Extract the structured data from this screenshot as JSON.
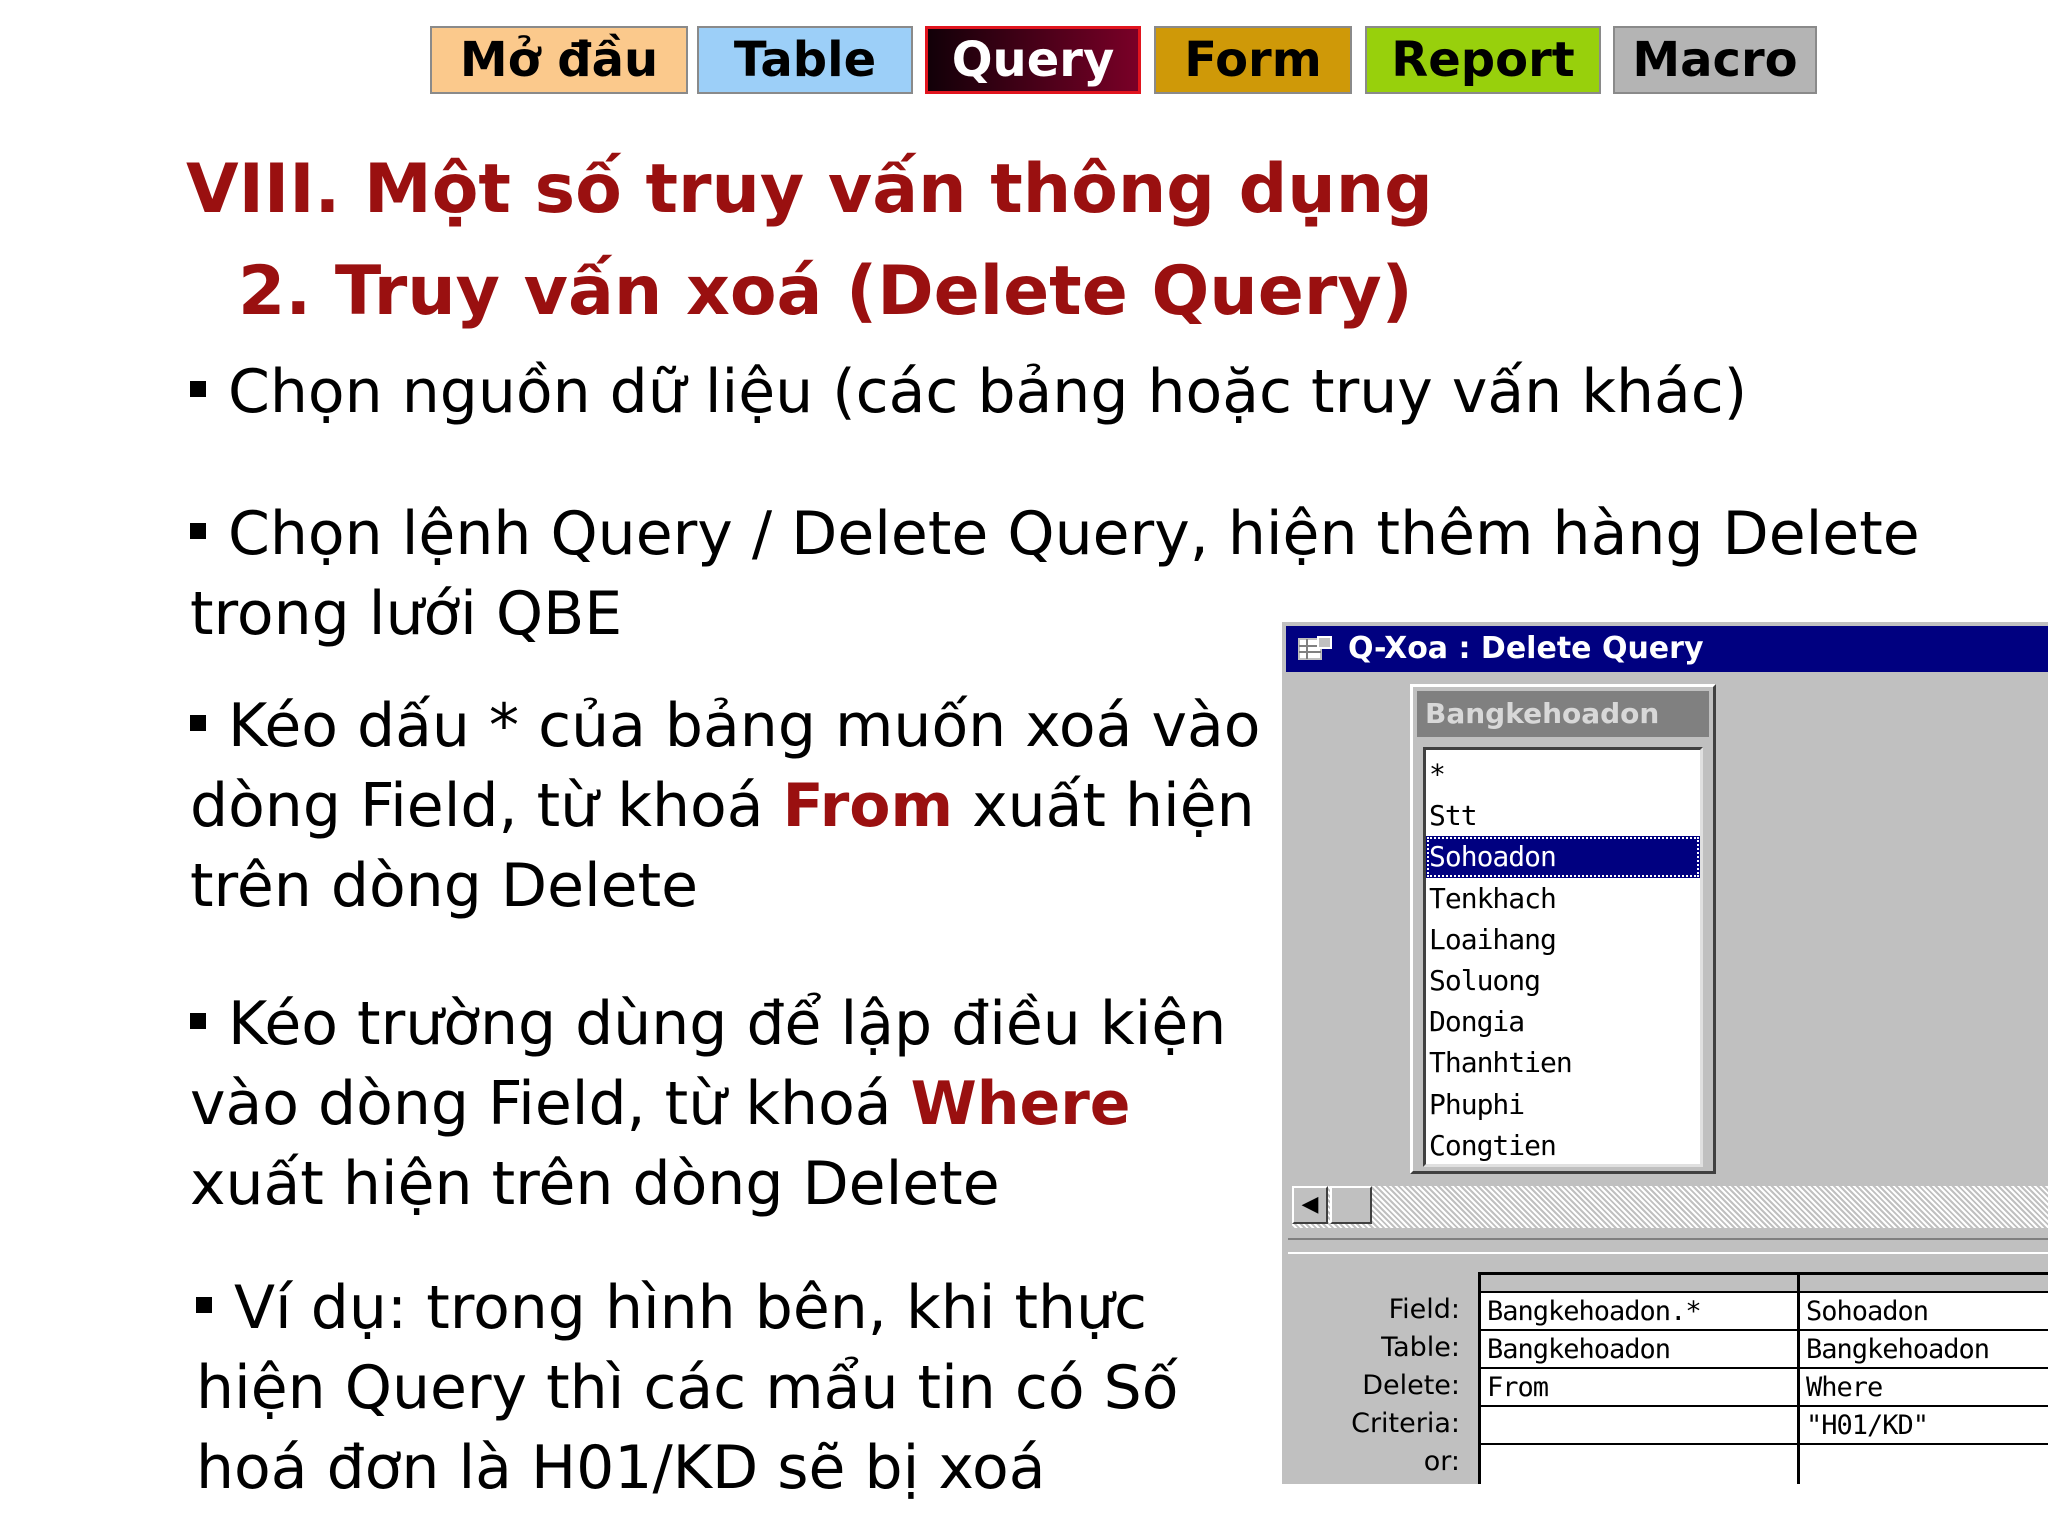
{
  "nav": {
    "tabs": [
      {
        "label": "Mở đầu"
      },
      {
        "label": "Table"
      },
      {
        "label": "Query"
      },
      {
        "label": "Form"
      },
      {
        "label": "Report"
      },
      {
        "label": "Macro"
      }
    ],
    "active_tab": "Query"
  },
  "headings": {
    "section": "VIII. Một số truy vấn thông dụng",
    "subsection": "2. Truy vấn xoá (Delete Query)"
  },
  "bullets": {
    "b1": "Chọn nguồn dữ liệu (các bảng hoặc truy vấn khác)",
    "b2": "Chọn lệnh Query / Delete Query, hiện thêm hàng Delete trong lưới QBE",
    "b3_pre": "Kéo dấu * của bảng muốn xoá vào dòng Field, từ khoá ",
    "b3_kw": "From",
    "b3_post": " xuất hiện trên dòng Delete",
    "b4_pre": "Kéo trường dùng để lập điều kiện vào dòng Field, từ khoá ",
    "b4_kw": "Where",
    "b4_post": " xuất hiện trên dòng Delete",
    "b5": "Ví dụ: trong hình bên, khi thực hiện Query thì các mẩu tin có Số hoá đơn là H01/KD sẽ bị xoá"
  },
  "query_window": {
    "title": "Q-Xoa : Delete Query",
    "table_name": "Bangkehoadon",
    "fields": [
      "*",
      "Stt",
      "Sohoadon",
      "Tenkhach",
      "Loaihang",
      "Soluong",
      "Dongia",
      "Thanhtien",
      "Phuphi",
      "Congtien"
    ],
    "selected_field": "Sohoadon",
    "grid": {
      "row_labels": [
        "Field:",
        "Table:",
        "Delete:",
        "Criteria:",
        "or:"
      ],
      "columns": [
        {
          "field": "Bangkehoadon.*",
          "table": "Bangkehoadon",
          "delete": "From",
          "criteria": ""
        },
        {
          "field": "Sohoadon",
          "table": "Bangkehoadon",
          "delete": "Where",
          "criteria": "\"H01/KD\""
        }
      ]
    }
  },
  "colors": {
    "heading": "#9a1010",
    "keyword": "#9a1010",
    "titlebar": "#000080",
    "tab_mo_dau": "#fbc98c",
    "tab_table": "#9ccff8",
    "tab_query": "#7a0027",
    "tab_form": "#cf9908",
    "tab_report": "#98d00c",
    "tab_macro": "#b4b4b4"
  }
}
